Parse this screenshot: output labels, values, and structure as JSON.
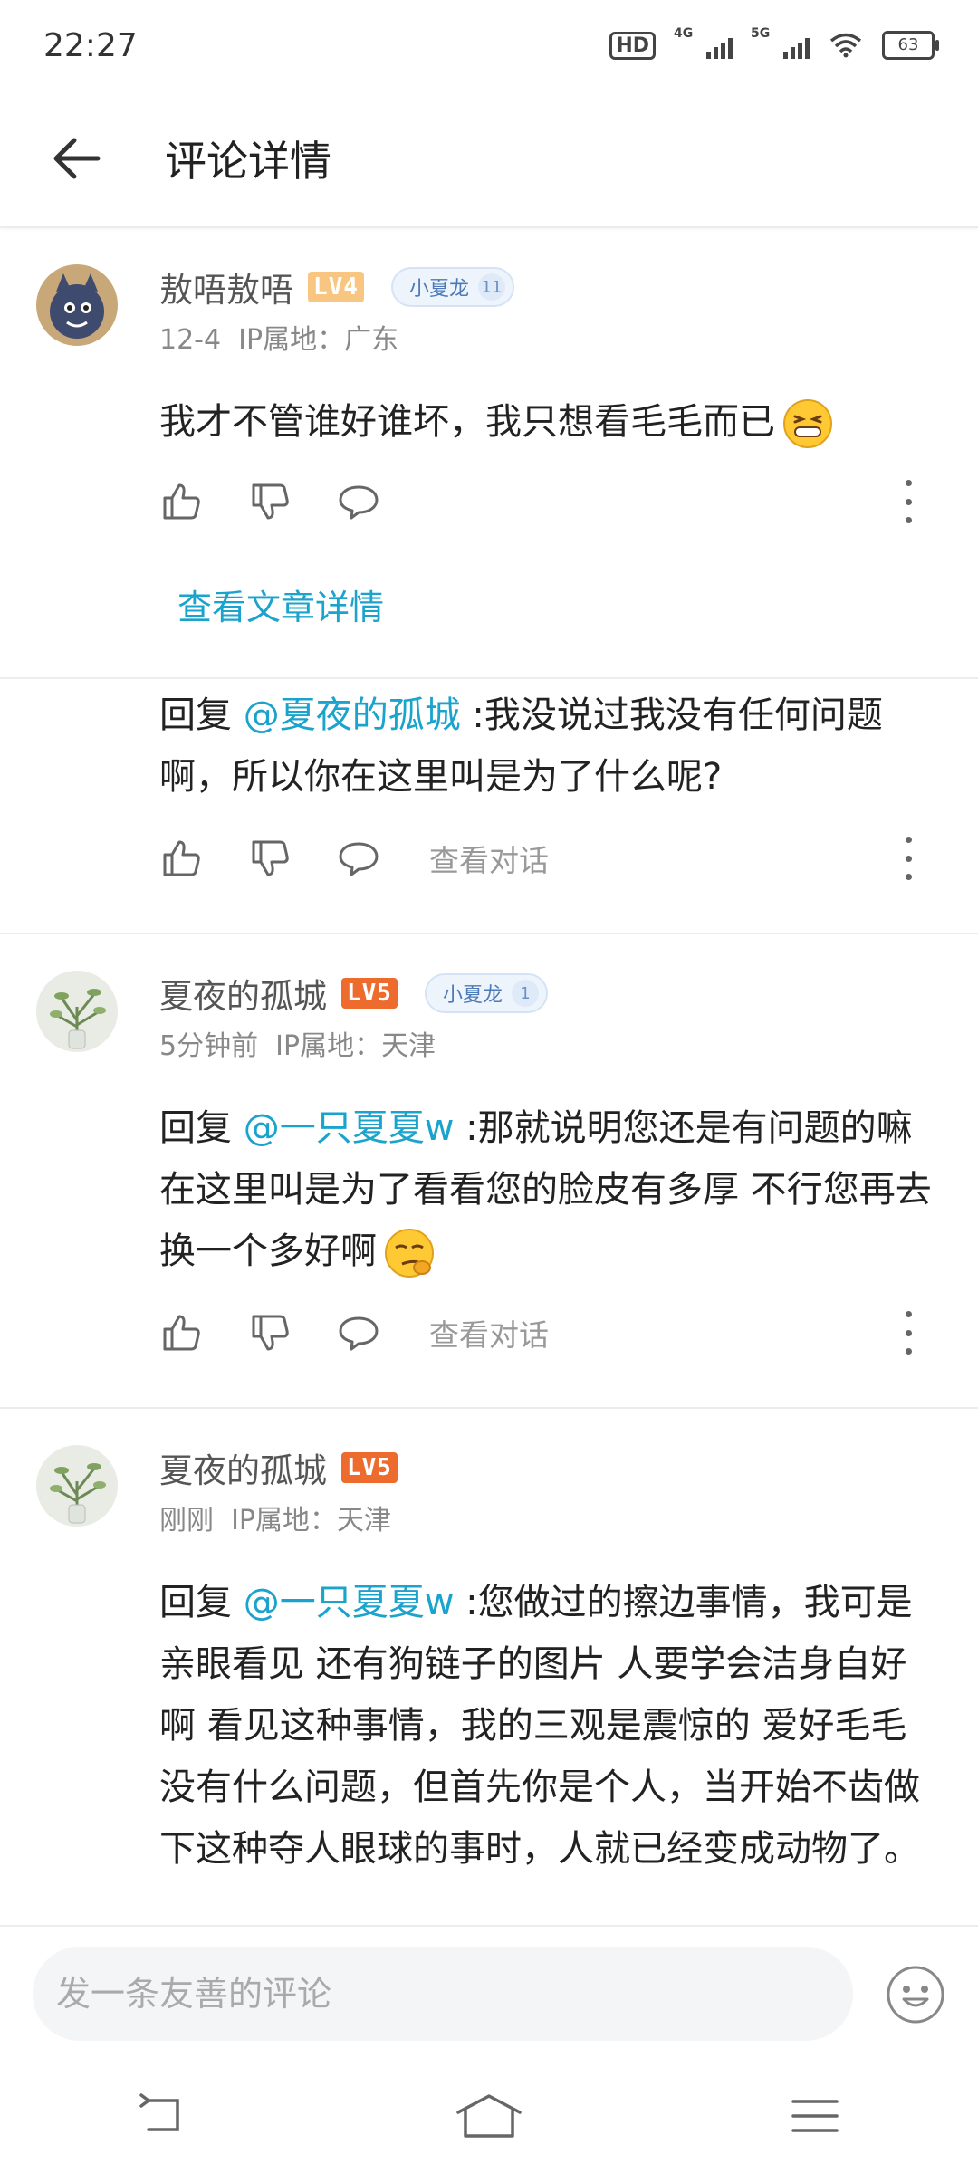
{
  "status_bar": {
    "time": "22:27",
    "network_1": "4G",
    "network_2": "5G",
    "battery": "63"
  },
  "header": {
    "title": "评论详情"
  },
  "comments": [
    {
      "username": "敖唔敖唔",
      "level": "LV4",
      "fan_badge": "小夏龙",
      "fan_level": "11",
      "time": "12-4",
      "ip": "IP属地：广东",
      "text": "我才不管谁好谁坏，我只想看毛毛而已"
    },
    {
      "reply_prefix": "回复 ",
      "mention": "@夏夜的孤城",
      "text": " :我没说过我没有任何问题啊，所以你在这里叫是为了什么呢?",
      "view_dialog": "查看对话"
    },
    {
      "username": "夏夜的孤城",
      "level": "LV5",
      "fan_badge": "小夏龙",
      "fan_level": "1",
      "time": "5分钟前",
      "ip": "IP属地：天津",
      "reply_prefix": "回复 ",
      "mention": "@一只夏夏w",
      "text": " :那就说明您还是有问题的嘛 在这里叫是为了看看您的脸皮有多厚 不行您再去换一个多好啊",
      "view_dialog": "查看对话"
    },
    {
      "username": "夏夜的孤城",
      "level": "LV5",
      "time": "刚刚",
      "ip": "IP属地：天津",
      "reply_prefix": "回复 ",
      "mention": "@一只夏夏w",
      "text": " :您做过的擦边事情，我可是亲眼看见  还有狗链子的图片  人要学会洁身自好啊 看见这种事情，我的三观是震惊的  爱好毛毛没有什么问题，但首先你是个人，当开始不齿做下这种夺人眼球的事时，人就已经变成动物了。"
    }
  ],
  "article_link": "查看文章详情",
  "input": {
    "placeholder": "发一条友善的评论"
  },
  "colors": {
    "accent": "#1aa3cc",
    "lv4": "#f8c680",
    "lv5": "#ec6b2d"
  }
}
